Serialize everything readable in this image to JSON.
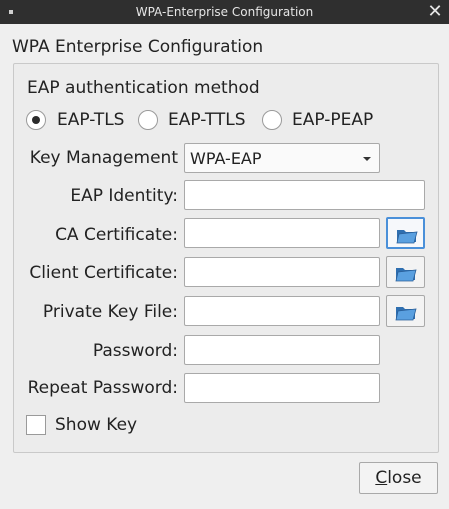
{
  "window": {
    "title": "WPA-Enterprise Configuration",
    "close_glyph": "✕"
  },
  "dialog": {
    "heading": "WPA Enterprise Configuration",
    "eap_section_title": "EAP authentication method",
    "eap_methods": [
      {
        "label": "EAP-TLS",
        "selected": true
      },
      {
        "label": "EAP-TTLS",
        "selected": false
      },
      {
        "label": "EAP-PEAP",
        "selected": false
      }
    ],
    "key_management": {
      "label": "Key Management",
      "value": "WPA-EAP"
    },
    "fields": {
      "eap_identity": {
        "label": "EAP Identity:",
        "value": ""
      },
      "ca_certificate": {
        "label": "CA Certificate:",
        "value": ""
      },
      "client_certificate": {
        "label": "Client Certificate:",
        "value": ""
      },
      "private_key_file": {
        "label": "Private Key File:",
        "value": ""
      },
      "password": {
        "label": "Password:",
        "value": ""
      },
      "repeat_password": {
        "label": "Repeat Password:",
        "value": ""
      }
    },
    "show_key": {
      "label": "Show Key",
      "checked": false
    },
    "close_button": {
      "mnemonic": "C",
      "rest": "lose"
    }
  },
  "icons": {
    "browse": "folder-open-icon",
    "folder_color": "#3b82c4"
  }
}
